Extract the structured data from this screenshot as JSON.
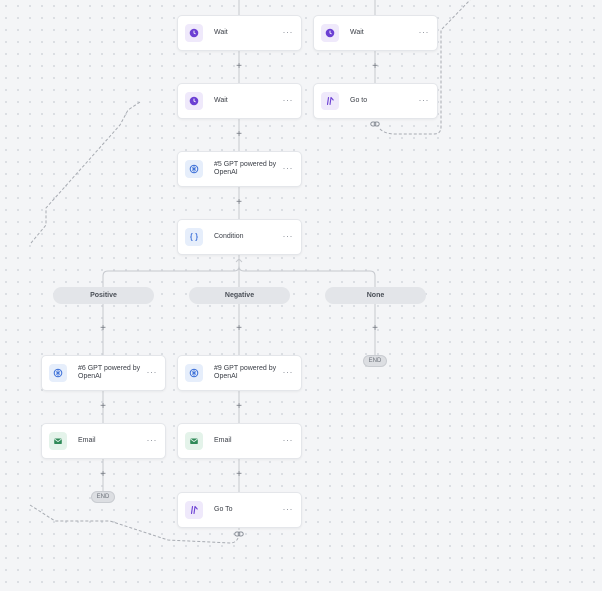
{
  "nodes": {
    "wait_1": {
      "label": "Wait"
    },
    "wait_2": {
      "label": "Wait"
    },
    "wait_3": {
      "label": "Wait"
    },
    "goto_1": {
      "label": "Go to"
    },
    "gpt_5": {
      "label": "#5 GPT powered by OpenAI"
    },
    "condition": {
      "label": "Condition"
    },
    "gpt_6": {
      "label": "#6 GPT powered by OpenAI"
    },
    "gpt_9": {
      "label": "#9 GPT powered by OpenAI"
    },
    "email_1": {
      "label": "Email"
    },
    "email_2": {
      "label": "Email"
    },
    "goto_2": {
      "label": "Go To"
    }
  },
  "branches": {
    "positive": "Positive",
    "negative": "Negative",
    "none": "None"
  },
  "end_label": "END",
  "add_symbol": "+",
  "more_symbol": "···",
  "colors": {
    "wait_icon": "#6b3fd3",
    "goto_icon": "#6b3fd3",
    "gpt_icon": "#3b6fd8",
    "email_icon": "#2f8a58",
    "connector": "#c6c9ce",
    "dashed_link": "#a7abb2"
  },
  "icons": {
    "wait": "clock-icon",
    "goto": "goto-arrows-icon",
    "gpt": "openai-icon",
    "condition": "braces-icon",
    "email": "envelope-icon",
    "link": "link-chain-icon",
    "more": "more-dots-icon",
    "add": "plus-icon"
  }
}
